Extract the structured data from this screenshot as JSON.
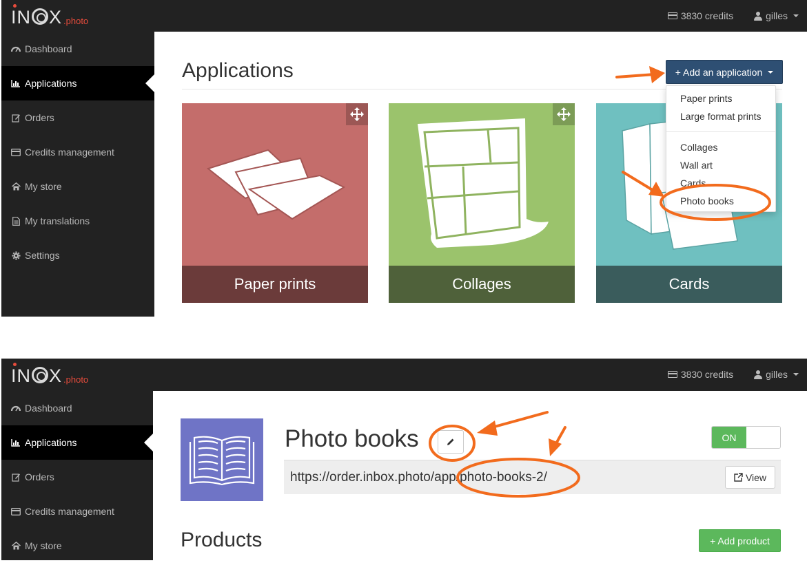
{
  "brand": {
    "logo_main": "INBOX",
    "logo_suffix": ".photo"
  },
  "topbar": {
    "credits": "3830 credits",
    "user": "gilles"
  },
  "sidebar1": [
    {
      "label": "Dashboard",
      "icon": "dashboard-icon"
    },
    {
      "label": "Applications",
      "icon": "bar-chart-icon",
      "active": true
    },
    {
      "label": "Orders",
      "icon": "edit-icon"
    },
    {
      "label": "Credits management",
      "icon": "credit-card-icon"
    },
    {
      "label": "My store",
      "icon": "home-icon"
    },
    {
      "label": "My translations",
      "icon": "document-icon"
    },
    {
      "label": "Settings",
      "icon": "gear-icon"
    }
  ],
  "sidebar2": [
    {
      "label": "Dashboard"
    },
    {
      "label": "Applications"
    },
    {
      "label": "Orders"
    },
    {
      "label": "Credits management"
    },
    {
      "label": "My store"
    }
  ],
  "applications": {
    "title": "Applications",
    "add_button": "+ Add an application",
    "dropdown": [
      "Paper prints",
      "Large format prints",
      "Collages",
      "Wall art",
      "Cards",
      "Photo books"
    ],
    "tiles": [
      {
        "label": "Paper prints",
        "color": "#c46d6b"
      },
      {
        "label": "Collages",
        "color": "#9bc36c"
      },
      {
        "label": "Cards",
        "color": "#6fc0c0"
      }
    ]
  },
  "app_detail": {
    "name": "Photo books",
    "status": "ON",
    "url": "https://order.inbox.photo/app/photo-books-2/",
    "view_button": "View",
    "products_title": "Products",
    "add_product_button": "+ Add product"
  },
  "colors": {
    "annotation": "#f26b1d",
    "primary": "#2e4f73",
    "success": "#5cb85c",
    "sidebar": "#222222"
  }
}
